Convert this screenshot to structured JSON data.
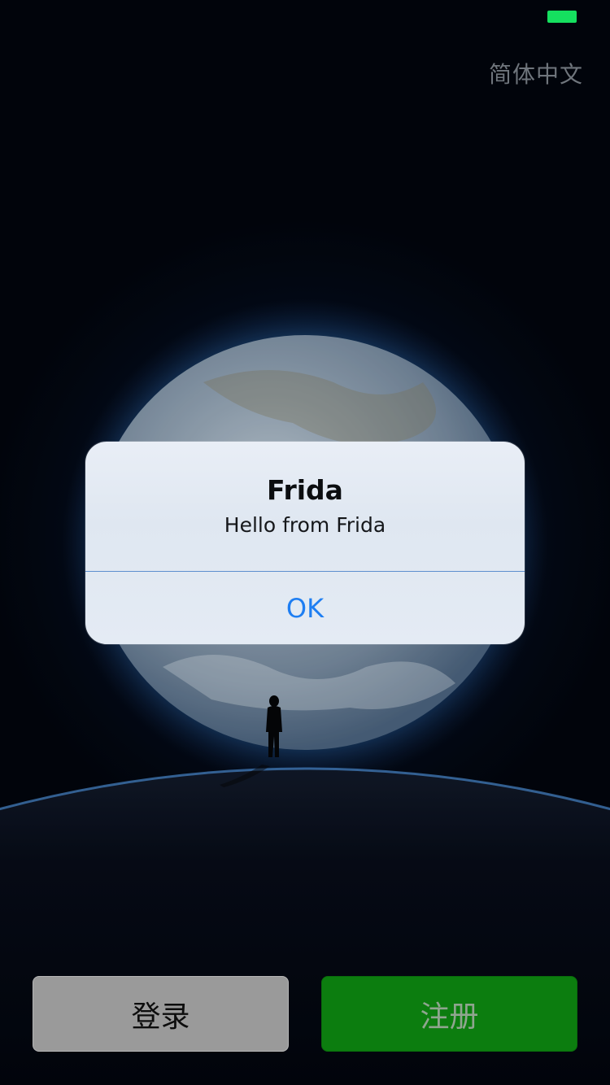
{
  "status_bar": {
    "battery_color": "#15e05f"
  },
  "header": {
    "language_label": "简体中文"
  },
  "alert": {
    "title": "Frida",
    "message": "Hello from Frida",
    "ok_label": "OK"
  },
  "actions": {
    "login_label": "登录",
    "register_label": "注册"
  },
  "colors": {
    "accent_blue": "#1e7ef2",
    "register_green": "#0c7d0f",
    "login_gray": "#9a9a9a"
  }
}
